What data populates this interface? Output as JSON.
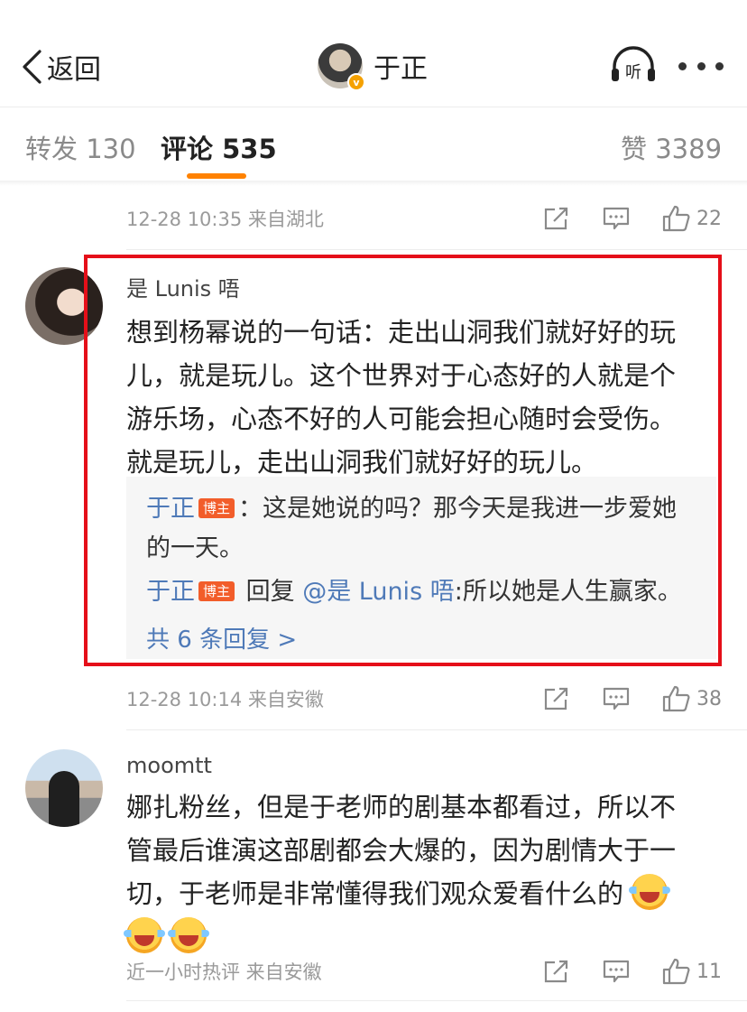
{
  "nav": {
    "back_label": "返回",
    "title": "于正",
    "listen_label": "听"
  },
  "tabs": [
    {
      "label": "转发 130"
    },
    {
      "label": "评论 535"
    },
    {
      "label": "赞 3389"
    }
  ],
  "top_row": {
    "meta": "12-28 10:35 来自湖北",
    "likes": "22"
  },
  "comments": [
    {
      "user": "是 Lunis 唔",
      "lines": [
        "想到杨幂说的一句话：走出山洞我们就好好的玩",
        "儿，就是玩儿。这个世界对于心态好的人就是个",
        "游乐场，心态不好的人可能会担心随时会受伤。",
        "就是玩儿，走出山洞我们就好好的玩儿。"
      ],
      "replies": [
        {
          "name": "于正",
          "badge": "博主",
          "line1": "：这是她说的吗？那今天是我进一步爱她",
          "line2": "的一天。"
        },
        {
          "name": "于正",
          "badge": "博主",
          "prefix": " 回复 ",
          "mention": "@是 Lunis 唔",
          "text": ":所以她是人生赢家。"
        }
      ],
      "more_replies": "共 6 条回复 >",
      "meta": "12-28 10:14 来自安徽",
      "likes": "38"
    },
    {
      "user": "moomtt",
      "lines": [
        "娜扎粉丝，但是于老师的剧基本都看过，所以不",
        "管最后谁演这部剧都会大爆的，因为剧情大于一",
        "切，于老师是非常懂得我们观众爱看什么的"
      ],
      "emoji": "laugh-cry-emoji",
      "meta": "近一小时热评 来自安徽",
      "likes": "11"
    }
  ],
  "colors": {
    "accent": "#ff8200",
    "link": "#4f7ab8",
    "highlight": "#e50f19",
    "blogger_badge": "#f25d2a"
  }
}
